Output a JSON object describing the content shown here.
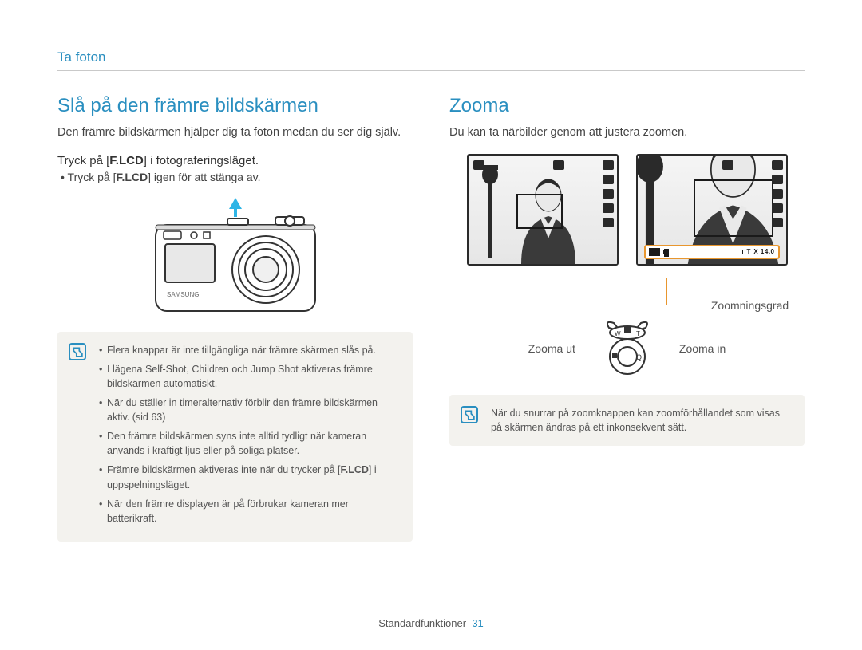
{
  "header": {
    "section": "Ta foton"
  },
  "left": {
    "heading": "Slå på den främre bildskärmen",
    "intro": "Den främre bildskärmen hjälper dig ta foton medan du ser dig själv.",
    "step_pre": "Tryck på [",
    "step_key": "F.LCD",
    "step_post": "] i fotograferingsläget.",
    "sub_pre": "Tryck på [",
    "sub_key": "F.LCD",
    "sub_post": "] igen för att stänga av.",
    "notes": [
      {
        "text": "Flera knappar är inte tillgängliga när främre skärmen slås på."
      },
      {
        "text": "I lägena Self-Shot, Children och Jump Shot aktiveras främre bildskärmen automatiskt."
      },
      {
        "text": "När du ställer in timeralternativ förblir den främre bildskärmen aktiv. (sid 63)"
      },
      {
        "text": "Den främre bildskärmen syns inte alltid tydligt när kameran används i kraftigt ljus eller på soliga platser."
      },
      {
        "pre": "Främre bildskärmen aktiveras inte när du trycker på [",
        "key": "F.LCD",
        "post": "] i uppspelningsläget."
      },
      {
        "text": "När den främre displayen är på förbrukar kameran mer batterikraft."
      }
    ]
  },
  "right": {
    "heading": "Zooma",
    "intro": "Du kan ta närbilder genom att justera zoomen.",
    "zoom_bar_text": "X 14.0",
    "zoom_grade": "Zoomningsgrad",
    "zoom_out": "Zooma ut",
    "zoom_in": "Zooma in",
    "note": "När du snurrar på zoomknappen kan zoomförhållandet som visas på skärmen ändras på ett inkonsekvent sätt."
  },
  "footer": {
    "label": "Standardfunktioner",
    "page": "31"
  }
}
